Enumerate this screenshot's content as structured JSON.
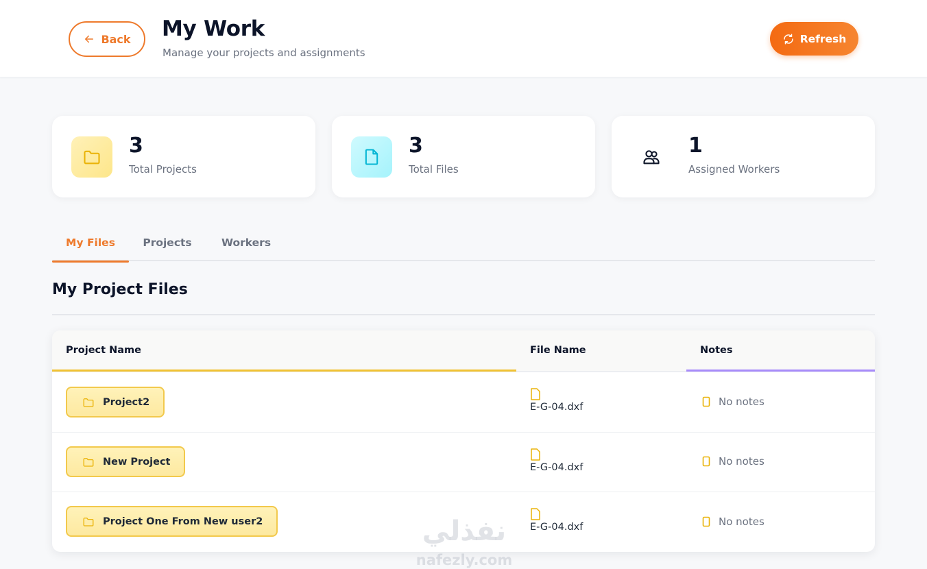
{
  "header": {
    "back_label": "Back",
    "title": "My Work",
    "subtitle": "Manage your projects and assignments",
    "refresh_label": "Refresh"
  },
  "stats": [
    {
      "value": "3",
      "label": "Total Projects",
      "icon": "folder-icon"
    },
    {
      "value": "3",
      "label": "Total Files",
      "icon": "file-icon"
    },
    {
      "value": "1",
      "label": "Assigned Workers",
      "icon": "users-icon"
    }
  ],
  "tabs": [
    {
      "label": "My Files",
      "active": true
    },
    {
      "label": "Projects",
      "active": false
    },
    {
      "label": "Workers",
      "active": false
    }
  ],
  "section": {
    "title": "My Project Files"
  },
  "table": {
    "columns": [
      "Project Name",
      "File Name",
      "Notes"
    ],
    "rows": [
      {
        "project": "Project2",
        "file": "E-G-04.dxf",
        "notes": "No notes"
      },
      {
        "project": "New Project",
        "file": "E-G-04.dxf",
        "notes": "No notes"
      },
      {
        "project": "Project One From New user2",
        "file": "E-G-04.dxf",
        "notes": "No notes"
      }
    ]
  },
  "watermark": {
    "arabic": "نفذلي",
    "latin": "nafezly.com"
  },
  "colors": {
    "accent": "#ee7a2c",
    "refresh_gradient_start": "#f46a12",
    "project_column_bar": "#f1c232",
    "notes_column_bar": "#a78bfa",
    "folder_tile": "#fde68a",
    "file_tile": "#a5f3fc"
  }
}
